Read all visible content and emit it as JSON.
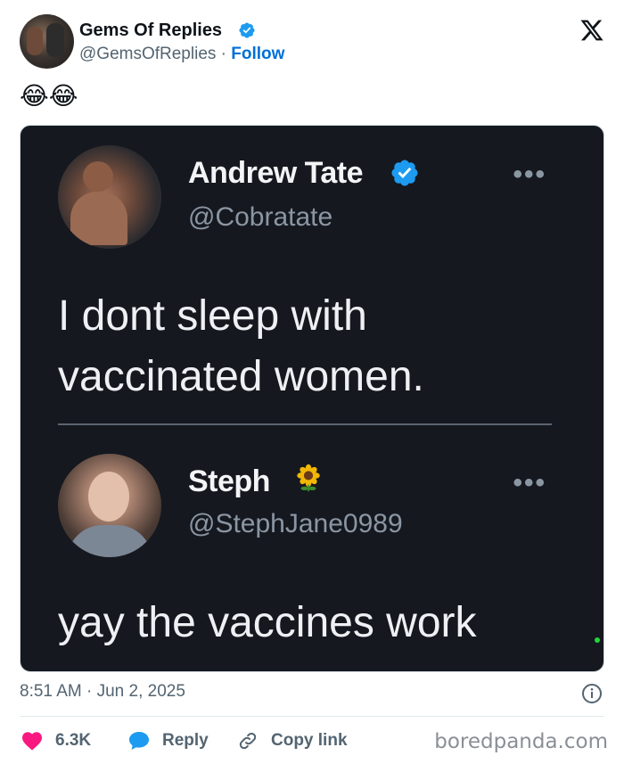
{
  "post": {
    "author_name": "Gems Of Replies",
    "author_handle": "@GemsOfReplies",
    "separator": "·",
    "follow_label": "Follow",
    "emoji_text": "😂😂",
    "timestamp": "8:51 AM · Jun 2, 2025",
    "like_count": "6.3K",
    "reply_label": "Reply",
    "copy_link_label": "Copy link"
  },
  "embedded_image": {
    "tweet1": {
      "name": "Andrew Tate",
      "handle": "@Cobratate",
      "more": "•••",
      "text_line1": "I dont sleep with",
      "text_line2": "vaccinated women."
    },
    "tweet2": {
      "name": "Steph",
      "handle": "@StephJane0989",
      "more": "•••",
      "text": "yay the vaccines work"
    }
  },
  "watermark": "boredpanda.com",
  "icons": {
    "verified": "verified-badge-icon",
    "x_logo": "x-logo-icon",
    "like": "heart-icon",
    "reply": "speech-bubble-icon",
    "copy_link": "link-icon",
    "info": "info-icon",
    "sunflower": "sunflower-icon"
  },
  "colors": {
    "accent": "#006fd6",
    "verified_blue": "#1d9bf0",
    "like_red": "#f91880",
    "embed_bg": "#15181f"
  }
}
